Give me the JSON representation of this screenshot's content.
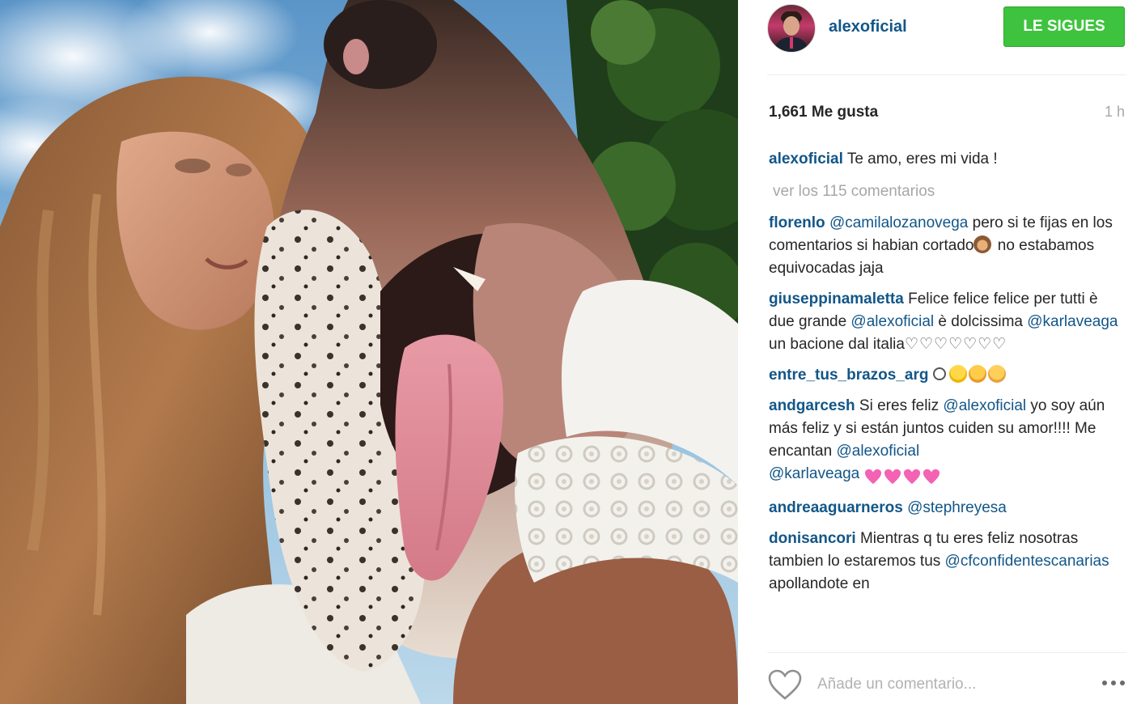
{
  "post": {
    "photo_alt": "",
    "author": "alexoficial",
    "follow_label": "LE SIGUES",
    "likes": "1,661 Me gusta",
    "time_ago": "1 h",
    "caption": {
      "user": "alexoficial",
      "text": "Te amo, eres mi vida !"
    },
    "view_all": "ver los 115 comentarios"
  },
  "comments": [
    {
      "user": "florenlo",
      "mention": "@camilalozanovega",
      "text1": " pero si te fijas en los comentarios si habian cortado",
      "text2": " no estabamos equivocadas jaja"
    },
    {
      "user": "giuseppinamaletta",
      "text1": " Felice felice felice per tutti è due grande ",
      "mention1": "@alexoficial",
      "text2": " è dolcissima ",
      "mention2": "@karlaveaga",
      "text3": " un bacione dal italia",
      "hearts": "♡♡♡♡♡♡♡"
    },
    {
      "user": "entre_tus_brazos_arg"
    },
    {
      "user": "andgarcesh",
      "text1": " Si eres feliz ",
      "mention1": "@alexoficial",
      "text2": " yo soy aún más feliz y si están juntos cuiden su amor!!!! Me encantan ",
      "mention2": "@alexoficial",
      "mention3": "@karlaveaga"
    },
    {
      "user": "andreaaguarneros",
      "mention": "@stephreyesa"
    },
    {
      "user": "donisancori",
      "text1": " Mientras q tu eres feliz nosotras tambien lo estaremos tus ",
      "mention": "@cfconfidentescanarias",
      "text2": " apollandote en"
    }
  ],
  "footer": {
    "comment_placeholder": "Añade un comentario..."
  },
  "icons": {
    "like": "heart-outline-icon",
    "more": "ellipsis-icon"
  },
  "colors": {
    "link": "#125688",
    "follow_bg": "#3ec33e",
    "muted": "#a5a7aa",
    "text": "#262626"
  }
}
